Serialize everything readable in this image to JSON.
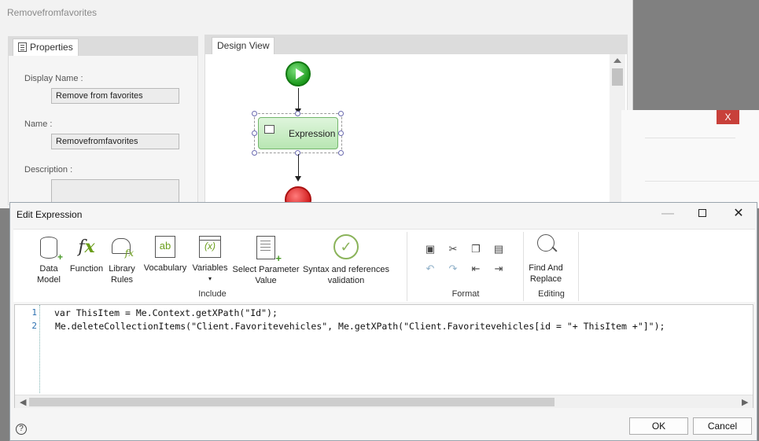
{
  "background_window": {
    "title": "Removefromfavorites",
    "properties_tab": "Properties",
    "design_tab": "Design View",
    "fields": [
      {
        "label": "Display Name :",
        "value": "Remove from favorites"
      },
      {
        "label": "Name :",
        "value": "Removefromfavorites"
      },
      {
        "label": "Description :",
        "value": ""
      }
    ],
    "workflow": {
      "expression_node": "Expression"
    }
  },
  "bg_dialog": {
    "close_label": "X"
  },
  "dialog": {
    "title": "Edit Expression",
    "window_controls": {
      "minimize": "—",
      "close": "✕"
    },
    "ribbon": {
      "include_group": {
        "label": "Include",
        "buttons": [
          {
            "id": "data-model",
            "line1": "Data",
            "line2": "Model"
          },
          {
            "id": "function",
            "line1": "Function",
            "line2": ""
          },
          {
            "id": "library-rules",
            "line1": "Library",
            "line2": "Rules"
          },
          {
            "id": "vocabulary",
            "line1": "Vocabulary",
            "line2": ""
          },
          {
            "id": "variables",
            "line1": "Variables",
            "line2": "▾"
          },
          {
            "id": "select-parameter-value",
            "line1": "Select Parameter",
            "line2": "Value"
          },
          {
            "id": "syntax-validation",
            "line1": "Syntax and references",
            "line2": "validation"
          }
        ],
        "icon_text": {
          "fx": "f",
          "fx_x": "x",
          "vocabulary": "ab",
          "variables": "(x)",
          "check": "✓"
        }
      },
      "format_group": {
        "label": "Format",
        "icons": [
          "save-icon",
          "cut-icon",
          "copy-icon",
          "paste-icon",
          "undo-icon",
          "redo-icon",
          "outdent-icon",
          "indent-icon"
        ]
      },
      "editing_group": {
        "label": "Editing",
        "find_replace_line1": "Find And",
        "find_replace_line2": "Replace"
      }
    },
    "code_lines": [
      {
        "num": "1",
        "text": "var ThisItem = Me.Context.getXPath(\"Id\");"
      },
      {
        "num": "2",
        "text": "Me.deleteCollectionItems(\"Client.Favoritevehicles\", Me.getXPath(\"Client.Favoritevehicles[id = \"+ ThisItem +\"]\");"
      }
    ],
    "ok_label": "OK",
    "cancel_label": "Cancel",
    "help_label": "?"
  }
}
